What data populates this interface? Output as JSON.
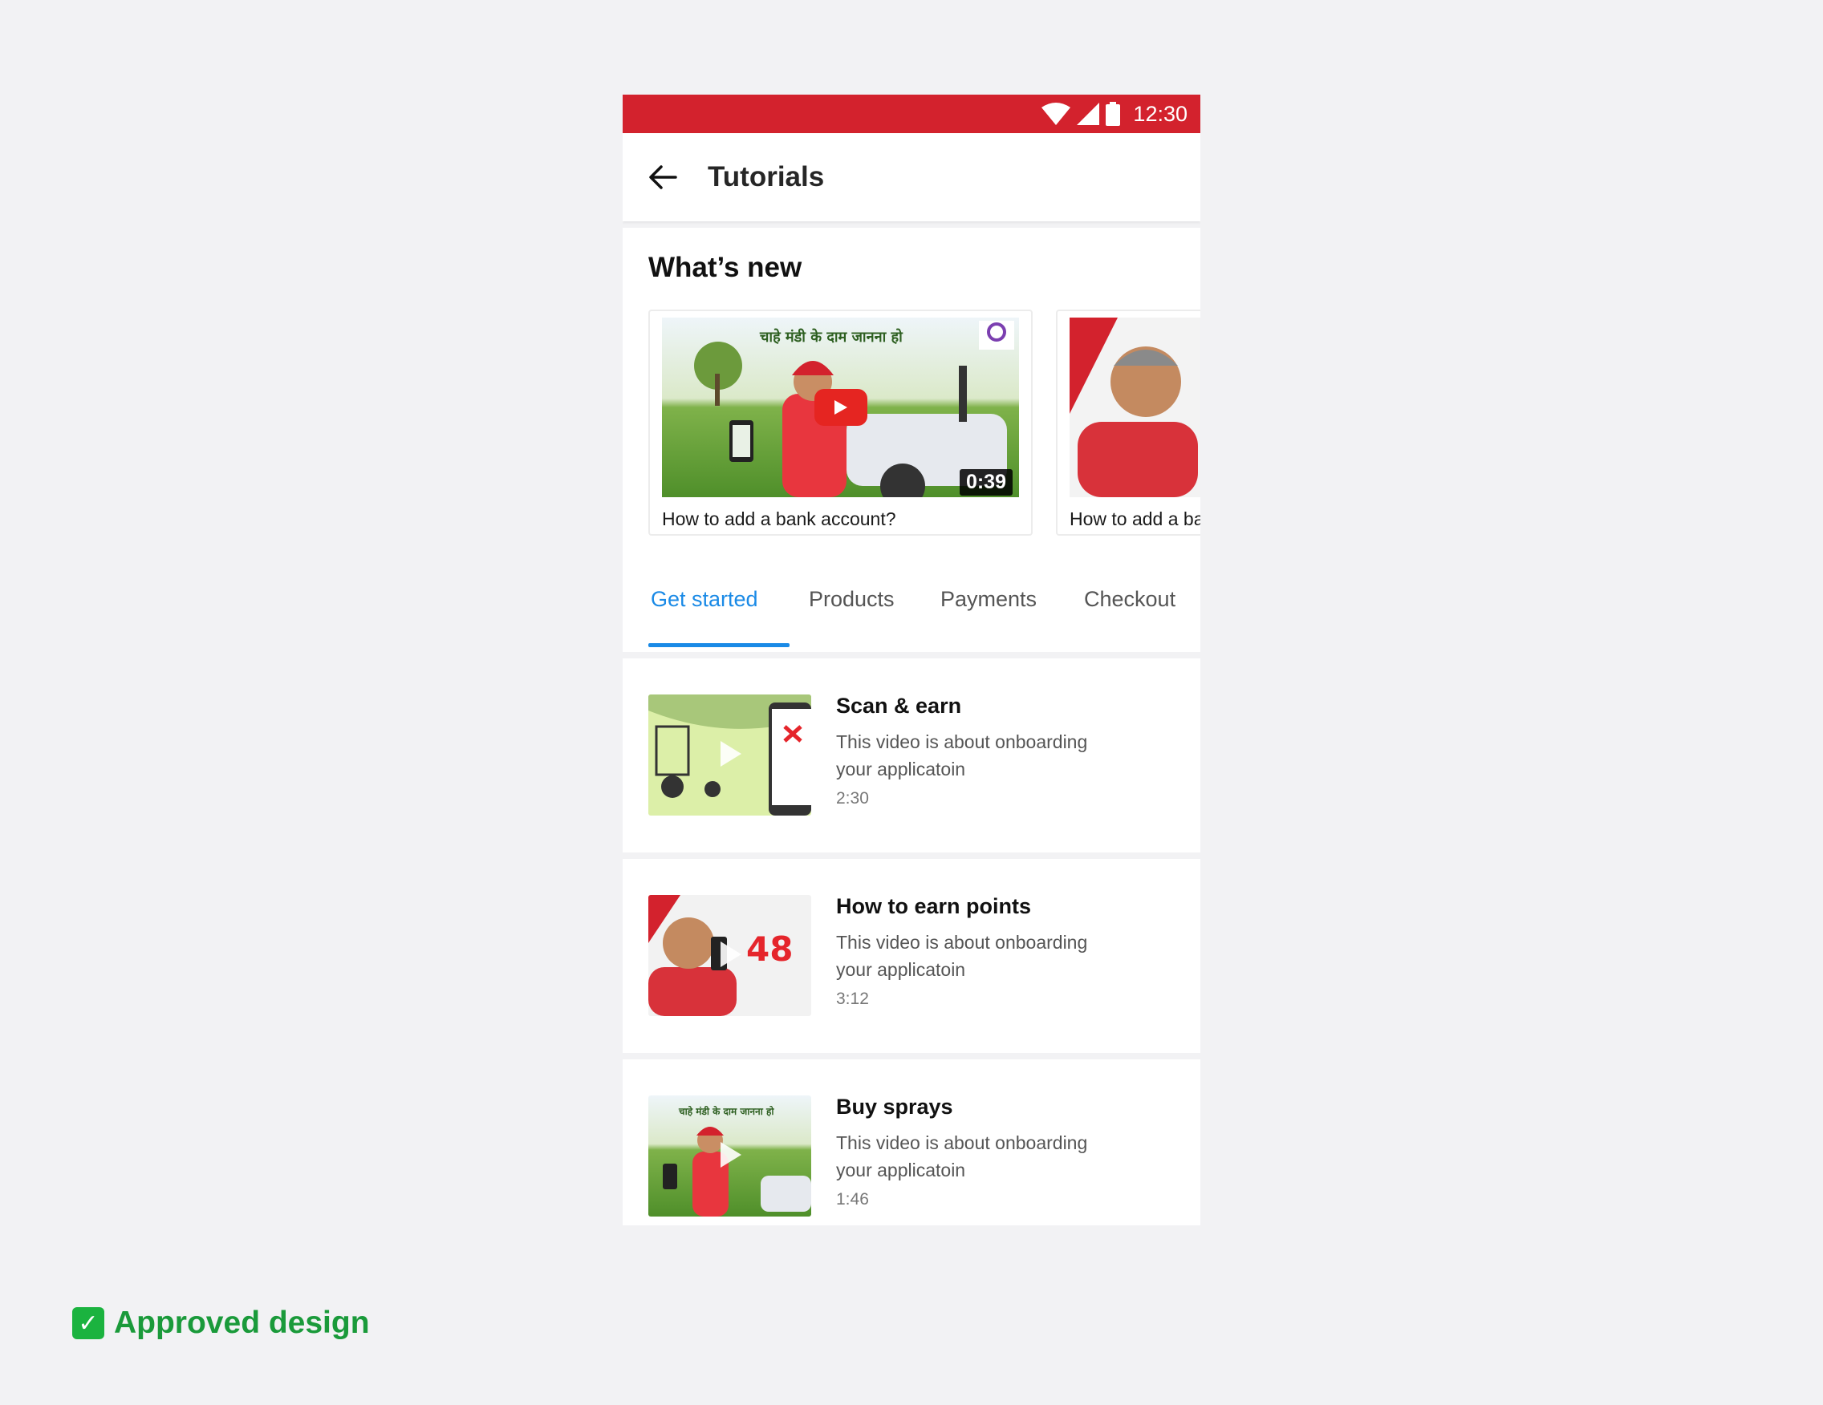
{
  "status_bar": {
    "time": "12:30"
  },
  "app_bar": {
    "title": "Tutorials"
  },
  "whats_new": {
    "heading": "What’s new",
    "cards": [
      {
        "caption": "How to add a bank account?",
        "duration": "0:39",
        "thumb_text": "चाहे मंडी के दाम जानना हो"
      },
      {
        "caption": "How to add a bank account?"
      }
    ]
  },
  "tabs": [
    {
      "label": "Get started",
      "active": true
    },
    {
      "label": "Products"
    },
    {
      "label": "Payments"
    },
    {
      "label": "Checkout"
    }
  ],
  "videos": [
    {
      "title": "Scan & earn",
      "description": "This video is about onboarding your applicatoin",
      "duration": "2:30"
    },
    {
      "title": "How to earn points",
      "description": "This video is about onboarding your applicatoin",
      "duration": "3:12",
      "thumb_text": "48"
    },
    {
      "title": "Buy sprays",
      "description": "This video is about onboarding your applicatoin",
      "duration": "1:46",
      "thumb_text": "चाहे मंडी के दाम जानना हो"
    }
  ],
  "footer": {
    "label": "Approved design"
  },
  "colors": {
    "brand_red": "#d3222d",
    "accent_blue": "#1a8ae6",
    "approved_green": "#1a9a3a"
  }
}
